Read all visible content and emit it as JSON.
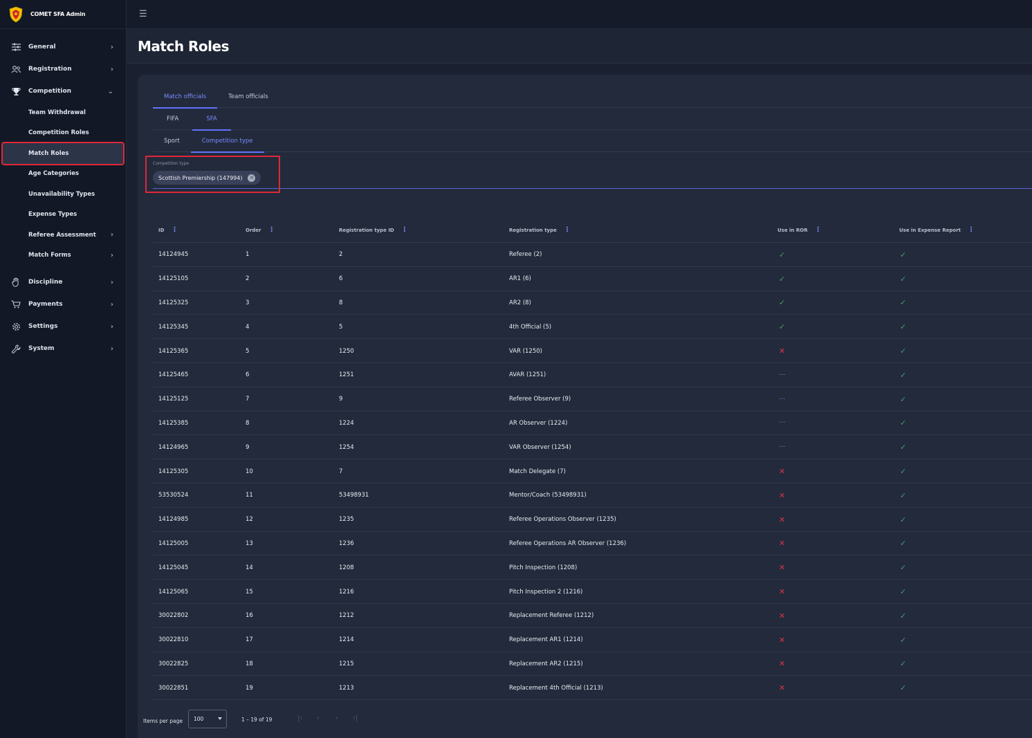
{
  "app": {
    "name": "COMET SFA Admin"
  },
  "page": {
    "title": "Match Roles"
  },
  "sidebar": {
    "items": [
      {
        "label": "General",
        "icon": "sliders-icon",
        "expanded": false
      },
      {
        "label": "Registration",
        "icon": "users-icon",
        "expanded": false
      },
      {
        "label": "Competition",
        "icon": "trophy-icon",
        "expanded": true
      },
      {
        "label": "Discipline",
        "icon": "hand-icon",
        "expanded": false
      },
      {
        "label": "Payments",
        "icon": "cart-icon",
        "expanded": false
      },
      {
        "label": "Settings",
        "icon": "gear-icon",
        "expanded": false
      },
      {
        "label": "System",
        "icon": "wrench-icon",
        "expanded": false
      }
    ],
    "competition_sub": [
      {
        "label": "Team Withdrawal",
        "has_children": false,
        "active": false
      },
      {
        "label": "Competition Roles",
        "has_children": false,
        "active": false
      },
      {
        "label": "Match Roles",
        "has_children": false,
        "active": true
      },
      {
        "label": "Age Categories",
        "has_children": false,
        "active": false
      },
      {
        "label": "Unavailability Types",
        "has_children": false,
        "active": false
      },
      {
        "label": "Expense Types",
        "has_children": false,
        "active": false
      },
      {
        "label": "Referee Assessment",
        "has_children": true,
        "active": false
      },
      {
        "label": "Match Forms",
        "has_children": true,
        "active": false
      }
    ]
  },
  "tabs_level1": [
    {
      "label": "Match officials",
      "active": true
    },
    {
      "label": "Team officials",
      "active": false
    }
  ],
  "tabs_level2": [
    {
      "label": "FIFA",
      "active": false
    },
    {
      "label": "SFA",
      "active": true
    }
  ],
  "tabs_level3": [
    {
      "label": "Sport",
      "active": false
    },
    {
      "label": "Competition type",
      "active": true
    }
  ],
  "filter": {
    "label": "Competition type",
    "chip": "Scottish Premiership (147994)"
  },
  "table": {
    "columns": [
      "ID",
      "Order",
      "Registration type ID",
      "Registration type",
      "Use in ROR",
      "Use in Expense Report"
    ],
    "rows": [
      {
        "id": "14124945",
        "order": "1",
        "reg_id": "2",
        "reg_type": "Referee (2)",
        "ror": "check",
        "exp": "check"
      },
      {
        "id": "14125105",
        "order": "2",
        "reg_id": "6",
        "reg_type": "AR1 (6)",
        "ror": "check",
        "exp": "check"
      },
      {
        "id": "14125325",
        "order": "3",
        "reg_id": "8",
        "reg_type": "AR2 (8)",
        "ror": "check",
        "exp": "check"
      },
      {
        "id": "14125345",
        "order": "4",
        "reg_id": "5",
        "reg_type": "4th Official (5)",
        "ror": "check",
        "exp": "check"
      },
      {
        "id": "14125365",
        "order": "5",
        "reg_id": "1250",
        "reg_type": "VAR (1250)",
        "ror": "cross",
        "exp": "check"
      },
      {
        "id": "14125465",
        "order": "6",
        "reg_id": "1251",
        "reg_type": "AVAR (1251)",
        "ror": "dots",
        "exp": "check"
      },
      {
        "id": "14125125",
        "order": "7",
        "reg_id": "9",
        "reg_type": "Referee Observer (9)",
        "ror": "dots",
        "exp": "check"
      },
      {
        "id": "14125385",
        "order": "8",
        "reg_id": "1224",
        "reg_type": "AR Observer (1224)",
        "ror": "dots",
        "exp": "check"
      },
      {
        "id": "14124965",
        "order": "9",
        "reg_id": "1254",
        "reg_type": "VAR Observer (1254)",
        "ror": "dots",
        "exp": "check"
      },
      {
        "id": "14125305",
        "order": "10",
        "reg_id": "7",
        "reg_type": "Match Delegate (7)",
        "ror": "cross",
        "exp": "check"
      },
      {
        "id": "53530524",
        "order": "11",
        "reg_id": "53498931",
        "reg_type": "Mentor/Coach (53498931)",
        "ror": "cross",
        "exp": "check"
      },
      {
        "id": "14124985",
        "order": "12",
        "reg_id": "1235",
        "reg_type": "Referee Operations Observer (1235)",
        "ror": "cross",
        "exp": "check"
      },
      {
        "id": "14125005",
        "order": "13",
        "reg_id": "1236",
        "reg_type": "Referee Operations AR Observer (1236)",
        "ror": "cross",
        "exp": "check"
      },
      {
        "id": "14125045",
        "order": "14",
        "reg_id": "1208",
        "reg_type": "Pitch Inspection (1208)",
        "ror": "cross",
        "exp": "check"
      },
      {
        "id": "14125065",
        "order": "15",
        "reg_id": "1216",
        "reg_type": "Pitch Inspection 2 (1216)",
        "ror": "cross",
        "exp": "check"
      },
      {
        "id": "30022802",
        "order": "16",
        "reg_id": "1212",
        "reg_type": "Replacement Referee (1212)",
        "ror": "cross",
        "exp": "check"
      },
      {
        "id": "30022810",
        "order": "17",
        "reg_id": "1214",
        "reg_type": "Replacement AR1 (1214)",
        "ror": "cross",
        "exp": "check"
      },
      {
        "id": "30022825",
        "order": "18",
        "reg_id": "1215",
        "reg_type": "Replacement AR2 (1215)",
        "ror": "cross",
        "exp": "check"
      },
      {
        "id": "30022851",
        "order": "19",
        "reg_id": "1213",
        "reg_type": "Replacement 4th Official (1213)",
        "ror": "cross",
        "exp": "check"
      }
    ]
  },
  "pagination": {
    "label": "Items per page",
    "per_page": "100",
    "range": "1 – 19 of 19"
  },
  "colors": {
    "accent": "#6272ff",
    "highlight": "#e0283a",
    "check": "#4f9a6f",
    "cross": "#d9354a"
  }
}
